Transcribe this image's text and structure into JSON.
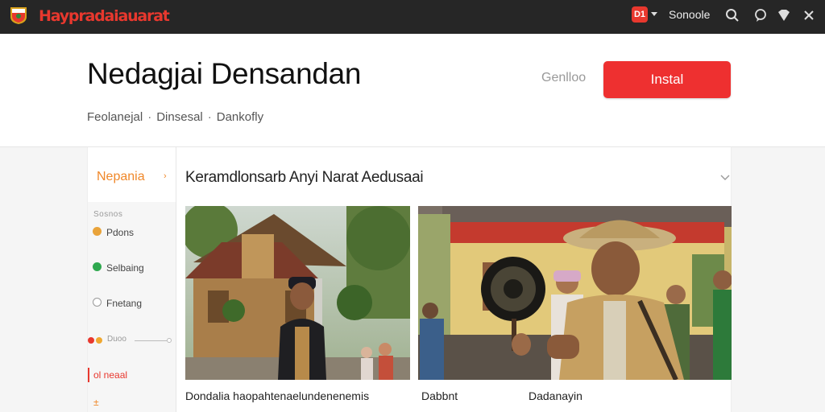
{
  "topbar": {
    "brand": "Haypradaiauarat",
    "app_badge": "D1",
    "user": "Sonoole",
    "icons": [
      "flag-logo-icon",
      "search-icon",
      "chat-icon",
      "gem-icon",
      "close-icon"
    ],
    "colors": {
      "bar": "#262626",
      "brand": "#e8382e"
    }
  },
  "header": {
    "title": "Nedagjai Densandan",
    "secondary_button": "Genlloo",
    "install_button": "Instal",
    "breadcrumbs": [
      "Feolanejal",
      "Dinsesal",
      "Dankofly"
    ],
    "colors": {
      "install": "#ee3030"
    }
  },
  "sidebar": {
    "header": "Nepania",
    "caption": "Sosnos",
    "items": [
      {
        "label": "Pdons",
        "color": "#e9a33a"
      },
      {
        "label": "Selbaing",
        "color": "#2fa84f"
      },
      {
        "label": "Fnetang",
        "color": "#9a9a9a"
      }
    ],
    "range_label": "Duoo",
    "active_item": "ol neaal",
    "more_label": "±"
  },
  "main": {
    "section_title": "Keramdlonsarb Anyi Narat Aedusaai",
    "cards": [
      {
        "caption": "Dondalia haopahtenaelundenenemis",
        "image": "traditional-house-photo"
      },
      {
        "caption": "Dabbnt",
        "image": "market-vendor-photo"
      },
      {
        "caption": "Dadanayin",
        "image": "market-vendor-photo"
      }
    ]
  }
}
